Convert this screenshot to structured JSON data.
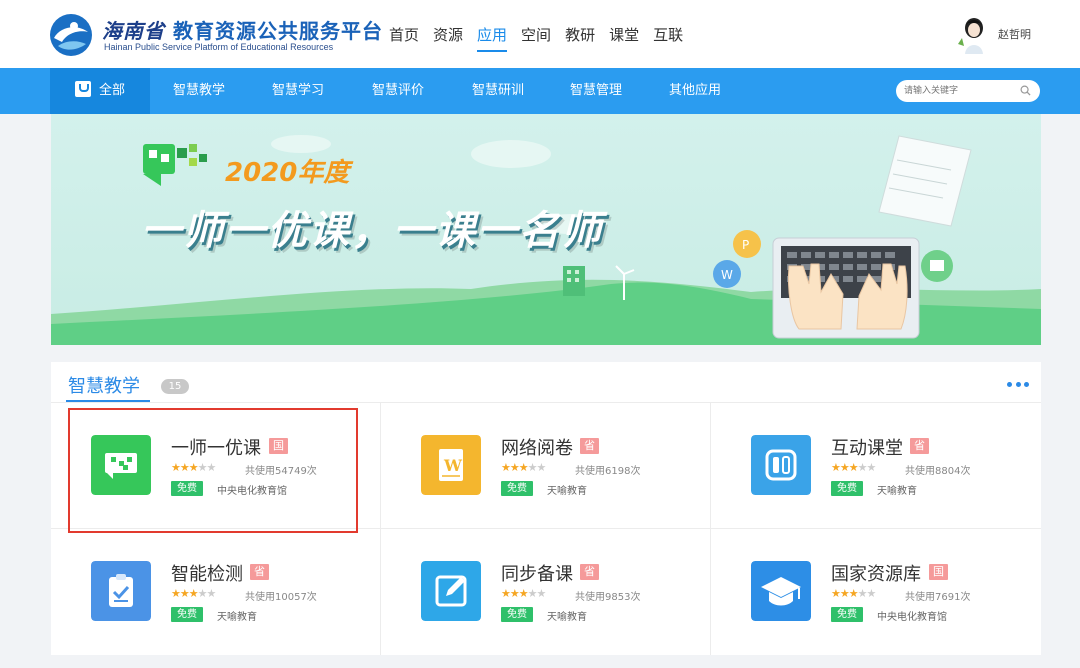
{
  "header": {
    "logo_title_a": "海南省",
    "logo_title_b": "教育资源公共服务平台",
    "logo_subtitle": "Hainan Public Service Platform of Educational Resources",
    "nav": [
      "首页",
      "资源",
      "应用",
      "空间",
      "教研",
      "课堂",
      "互联"
    ],
    "active_nav": "应用",
    "user_name": "赵哲明"
  },
  "categories": {
    "items": [
      "全部",
      "智慧教学",
      "智慧学习",
      "智慧评价",
      "智慧研训",
      "智慧管理",
      "其他应用"
    ],
    "active": "全部"
  },
  "search": {
    "placeholder": "请输入关键字"
  },
  "banner": {
    "year": "2020年度",
    "slogan": "一师一优课，一课一名师"
  },
  "section": {
    "title": "智慧教学",
    "count": "15"
  },
  "apps": [
    {
      "name": "一师一优课",
      "badge": "国",
      "rating": 3,
      "max_rating": 5,
      "uses": "共使用54749次",
      "price": "免费",
      "provider": "中央电化教育馆",
      "icon": "chat-flag-icon",
      "icon_color": "#36c75a",
      "highlighted": true
    },
    {
      "name": "网络阅卷",
      "badge": "省",
      "rating": 3,
      "max_rating": 5,
      "uses": "共使用6198次",
      "price": "免费",
      "provider": "天喻教育",
      "icon": "document-w-icon",
      "icon_color": "#f4b62e",
      "highlighted": false
    },
    {
      "name": "互动课堂",
      "badge": "省",
      "rating": 3,
      "max_rating": 5,
      "uses": "共使用8804次",
      "price": "免费",
      "provider": "天喻教育",
      "icon": "interactive-screen-icon",
      "icon_color": "#3aa3e8",
      "highlighted": false
    },
    {
      "name": "智能检测",
      "badge": "省",
      "rating": 3,
      "max_rating": 5,
      "uses": "共使用10057次",
      "price": "免费",
      "provider": "天喻教育",
      "icon": "clipboard-check-icon",
      "icon_color": "#4b93e6",
      "highlighted": false
    },
    {
      "name": "同步备课",
      "badge": "省",
      "rating": 3,
      "max_rating": 5,
      "uses": "共使用9853次",
      "price": "免费",
      "provider": "天喻教育",
      "icon": "edit-square-icon",
      "icon_color": "#2ea7e8",
      "highlighted": false
    },
    {
      "name": "国家资源库",
      "badge": "国",
      "rating": 3,
      "max_rating": 5,
      "uses": "共使用7691次",
      "price": "免费",
      "provider": "中央电化教育馆",
      "icon": "graduation-cap-icon",
      "icon_color": "#2d8ee6",
      "highlighted": false
    }
  ],
  "colors": {
    "primary_blue": "#2b9cf0",
    "active_blue": "#1687de",
    "badge_pink": "#f59a9a",
    "free_green": "#2fc06a",
    "star_gold": "#f5a623",
    "highlight_red": "#e23a2e"
  }
}
